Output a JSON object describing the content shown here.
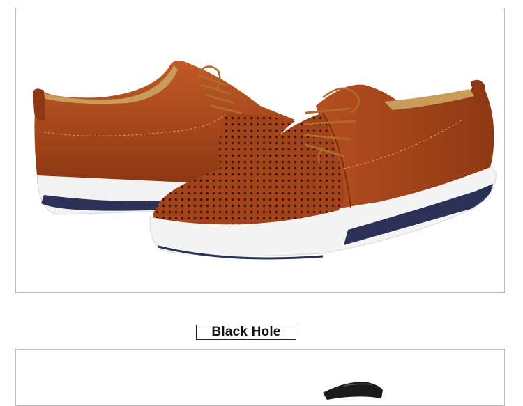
{
  "product_section": {
    "color_label": "Black Hole",
    "colors": {
      "leather": "#a2431c",
      "leather_dark": "#6e2a0e",
      "lining": "#c99c5c",
      "sole": "#f4f4f4",
      "sole_stripe": "#2c3158",
      "lace": "#b06a2a"
    }
  }
}
